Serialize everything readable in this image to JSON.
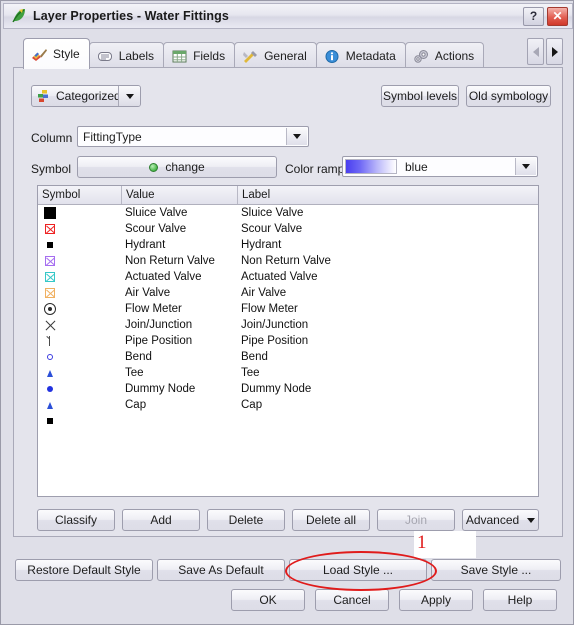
{
  "window": {
    "title": "Layer Properties - Water Fittings",
    "app_icon": "qgis-leaf-icon",
    "help_button": "?",
    "close_button": "✕"
  },
  "tabs": [
    {
      "label": "Style",
      "icon": "paintbrush-icon",
      "active": true
    },
    {
      "label": "Labels",
      "icon": "label-tag-icon",
      "active": false
    },
    {
      "label": "Fields",
      "icon": "table-grid-icon",
      "active": false
    },
    {
      "label": "General",
      "icon": "tools-icon",
      "active": false
    },
    {
      "label": "Metadata",
      "icon": "info-circle-icon",
      "active": false
    },
    {
      "label": "Actions",
      "icon": "gears-icon",
      "active": false
    }
  ],
  "tab_scroll": {
    "left": "◀",
    "right": "▶",
    "left_enabled": false,
    "right_enabled": true
  },
  "style_panel": {
    "renderer": {
      "label": "Categorized",
      "icon": "categorized-icon"
    },
    "symbol_levels_label": "Symbol levels",
    "old_symbology_label": "Old symbology",
    "column_label": "Column",
    "column_value": "FittingType",
    "symbol_label": "Symbol",
    "symbol_button_label": "change",
    "color_ramp_label": "Color ramp",
    "color_ramp_value": "blue",
    "color_ramp_start": "#4a3ff0",
    "color_ramp_end": "#ffffff"
  },
  "table": {
    "headers": [
      "Symbol",
      "Value",
      "Label"
    ],
    "rows": [
      {
        "symbol": "square-filled-large",
        "color": "#000000",
        "value": "Sluice Valve",
        "label": "Sluice Valve"
      },
      {
        "symbol": "valve-square",
        "color": "#ee2222",
        "value": "Scour Valve",
        "label": "Scour Valve"
      },
      {
        "symbol": "square-filled-small",
        "color": "#000000",
        "value": "Hydrant",
        "label": "Hydrant"
      },
      {
        "symbol": "valve-square",
        "color": "#a66ef0",
        "value": "Non Return Valve",
        "label": "Non Return Valve"
      },
      {
        "symbol": "valve-square",
        "color": "#36c8c8",
        "value": "Actuated Valve",
        "label": "Actuated Valve"
      },
      {
        "symbol": "valve-square",
        "color": "#f0b060",
        "value": "Air Valve",
        "label": "Air Valve"
      },
      {
        "symbol": "circle-dot",
        "color": "#2b2b2b",
        "value": "Flow Meter",
        "label": "Flow Meter"
      },
      {
        "symbol": "x-cross",
        "color": "#3a3a3a",
        "value": "Join/Junction",
        "label": "Join/Junction"
      },
      {
        "symbol": "arrow-up",
        "color": "#4a4a4a",
        "value": "Pipe Position",
        "label": "Pipe Position"
      },
      {
        "symbol": "circle-outline",
        "color": "#3c3ce0",
        "value": "Bend",
        "label": "Bend"
      },
      {
        "symbol": "triangle-up",
        "color": "#2b4fd8",
        "value": "Tee",
        "label": "Tee"
      },
      {
        "symbol": "circle-filled",
        "color": "#2232e0",
        "value": "Dummy Node",
        "label": "Dummy Node"
      },
      {
        "symbol": "triangle-up",
        "color": "#2b4fd8",
        "value": "Cap",
        "label": "Cap"
      },
      {
        "symbol": "square-filled-small",
        "color": "#000000",
        "value": "",
        "label": ""
      }
    ]
  },
  "class_buttons": {
    "classify": "Classify",
    "add": "Add",
    "delete": "Delete",
    "delete_all": "Delete all",
    "join": "Join",
    "join_enabled": false,
    "advanced": "Advanced"
  },
  "style_buttons": {
    "restore_default": "Restore Default Style",
    "save_as_default": "Save As Default",
    "load_style": "Load Style ...",
    "save_style": "Save Style ..."
  },
  "dialog_buttons": {
    "ok": "OK",
    "cancel": "Cancel",
    "apply": "Apply",
    "help": "Help"
  },
  "annotation": {
    "number": "1",
    "color": "#e01b1b",
    "target": "load-style-btn"
  }
}
